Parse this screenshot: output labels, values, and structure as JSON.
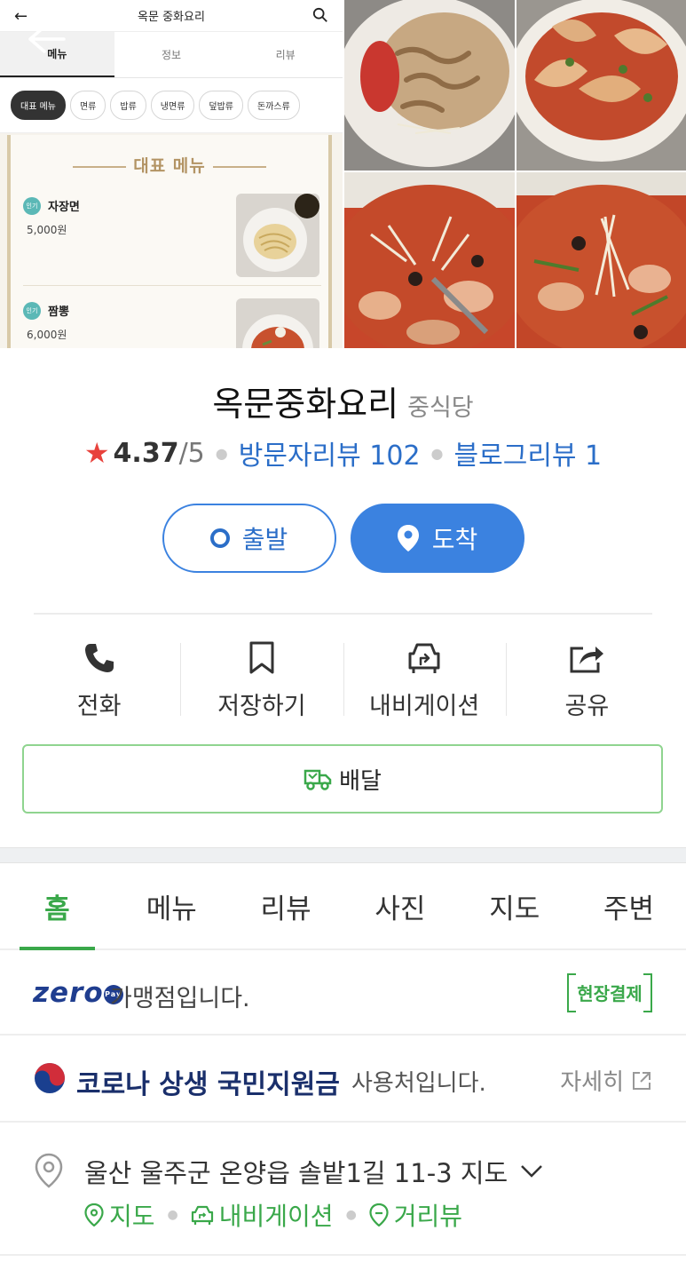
{
  "menu_screenshot": {
    "title": "옥문 중화요리",
    "tabs": [
      "메뉴",
      "정보",
      "리뷰"
    ],
    "categories": [
      "대표 메뉴",
      "면류",
      "밥류",
      "냉면류",
      "덮밥류",
      "돈까스류"
    ],
    "board_title": "대표 메뉴",
    "items": [
      {
        "badge": "인기",
        "name": "자장면",
        "price": "5,000원"
      },
      {
        "badge": "인기",
        "name": "짬뽕",
        "price": "6,000원"
      }
    ]
  },
  "place": {
    "name": "옥문중화요리",
    "category": "중식당",
    "rating": "4.37",
    "rating_max": "/5",
    "visitor_reviews": "방문자리뷰 102",
    "blog_reviews": "블로그리뷰 1"
  },
  "route": {
    "depart": "출발",
    "arrive": "도착"
  },
  "actions": [
    {
      "label": "전화",
      "icon": "phone-icon"
    },
    {
      "label": "저장하기",
      "icon": "bookmark-icon"
    },
    {
      "label": "내비게이션",
      "icon": "car-navigation-icon"
    },
    {
      "label": "공유",
      "icon": "share-icon"
    }
  ],
  "delivery": {
    "label": "배달",
    "icon": "delivery-truck-icon"
  },
  "tabs": [
    "홈",
    "메뉴",
    "리뷰",
    "사진",
    "지도",
    "주변"
  ],
  "zeropay": {
    "logo_text": "zero",
    "logo_pay": "Pay",
    "text": "가맹점입니다.",
    "tag": "현장결제"
  },
  "corona": {
    "title": "코로나 상생 국민지원금",
    "text": "사용처입니다.",
    "link": "자세히"
  },
  "address": {
    "text": "울산 울주군 온양읍 솔밭1길 11-3",
    "map_toggle": "지도",
    "links": [
      "지도",
      "내비게이션",
      "거리뷰"
    ]
  },
  "colors": {
    "accent_green": "#3aa84a",
    "accent_blue": "#3b82e0",
    "star_red": "#e8423c"
  }
}
